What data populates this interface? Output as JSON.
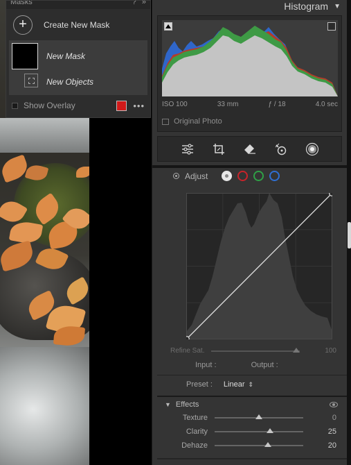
{
  "masks_panel": {
    "title": "Masks",
    "create_label": "Create New Mask",
    "mask_name": "New Mask",
    "component_name": "New Objects",
    "show_overlay_label": "Show Overlay",
    "overlay_color": "#d11a1a"
  },
  "histogram": {
    "title": "Histogram",
    "iso": "ISO 100",
    "focal": "33 mm",
    "aperture": "ƒ / 18",
    "shutter": "4.0 sec",
    "original_photo_label": "Original Photo"
  },
  "tools": [
    "sliders-icon",
    "crop-icon",
    "eraser-icon",
    "heal-icon",
    "mask-icon"
  ],
  "curve": {
    "adjust_label": "Adjust",
    "channels": [
      {
        "name": "point",
        "color": "#e8e8e8"
      },
      {
        "name": "red",
        "color": "#c9232a"
      },
      {
        "name": "green",
        "color": "#2fa046"
      },
      {
        "name": "blue",
        "color": "#2f6fd3"
      }
    ],
    "refine_label": "Refine Sat.",
    "refine_value": "100",
    "input_label": "Input :",
    "output_label": "Output :",
    "preset_label": "Preset :",
    "preset_value": "Linear"
  },
  "effects": {
    "title": "Effects",
    "sliders": [
      {
        "name": "Texture",
        "value": "0",
        "pos": 0.5
      },
      {
        "name": "Clarity",
        "value": "25",
        "pos": 0.625
      },
      {
        "name": "Dehaze",
        "value": "20",
        "pos": 0.6
      }
    ]
  }
}
